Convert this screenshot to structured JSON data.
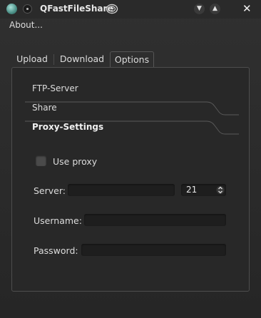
{
  "window": {
    "title": "QFastFileShare"
  },
  "menubar": {
    "about": "About..."
  },
  "tabs": [
    {
      "label": "Upload"
    },
    {
      "label": "Download"
    },
    {
      "label": "Options"
    }
  ],
  "toolbox": {
    "items": [
      {
        "label": "FTP-Server"
      },
      {
        "label": "Share"
      },
      {
        "label": "Proxy-Settings"
      }
    ]
  },
  "proxy": {
    "use_proxy_label": "Use proxy",
    "use_proxy_checked": false,
    "server_label": "Server:",
    "server_value": "",
    "port_value": "21",
    "username_label": "Username:",
    "username_value": "",
    "password_label": "Password:",
    "password_value": ""
  },
  "icons": {
    "app": "app-icon",
    "menu": "window-menu-icon",
    "title_deco": "spiral-icon",
    "minimize": "chevron-down-icon",
    "maximize": "chevron-up-icon",
    "close": "close-icon"
  },
  "colors": {
    "background": "#2b2b2b",
    "text": "#dcdcdc",
    "input_bg": "#1e1e1e",
    "border": "#4d4d4d"
  }
}
